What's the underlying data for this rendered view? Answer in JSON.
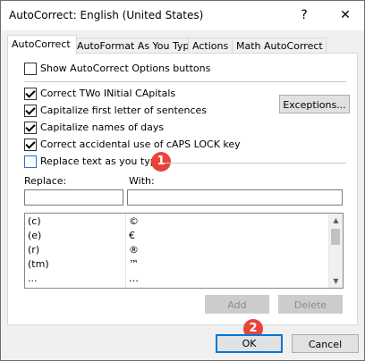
{
  "window": {
    "title": "AutoCorrect: English (United States)",
    "help_label": "?",
    "close_label": "✕"
  },
  "tabs": [
    {
      "label": "AutoCorrect",
      "active": true
    },
    {
      "label": "AutoFormat As You Type"
    },
    {
      "label": "Actions"
    },
    {
      "label": "Math AutoCorrect"
    }
  ],
  "options": {
    "show_buttons": {
      "label": "Show AutoCorrect Options buttons",
      "checked": false
    },
    "two_initial": {
      "label": "Correct TWo INitial CApitals",
      "checked": true
    },
    "first_letter": {
      "label": "Capitalize first letter of sentences",
      "checked": true
    },
    "days": {
      "label": "Capitalize names of days",
      "checked": true
    },
    "caps_lock": {
      "label": "Correct accidental use of cAPS LOCK key",
      "checked": true
    },
    "replace_text": {
      "label": "Replace text as you type",
      "checked": false
    }
  },
  "exceptions_label": "Exceptions...",
  "replace": {
    "replace_label": "Replace:",
    "with_label": "With:",
    "replace_value": "",
    "with_value": "",
    "rows": [
      {
        "from": "(c)",
        "to": "©"
      },
      {
        "from": "(e)",
        "to": "€"
      },
      {
        "from": "(r)",
        "to": "®"
      },
      {
        "from": "(tm)",
        "to": "™"
      },
      {
        "from": "...",
        "to": "…"
      }
    ]
  },
  "buttons": {
    "add": "Add",
    "delete": "Delete",
    "ok": "OK",
    "cancel": "Cancel"
  },
  "callouts": {
    "one": "1",
    "two": "2"
  },
  "colors": {
    "callout": "#e8443a",
    "focus_border": "#0078d7"
  }
}
